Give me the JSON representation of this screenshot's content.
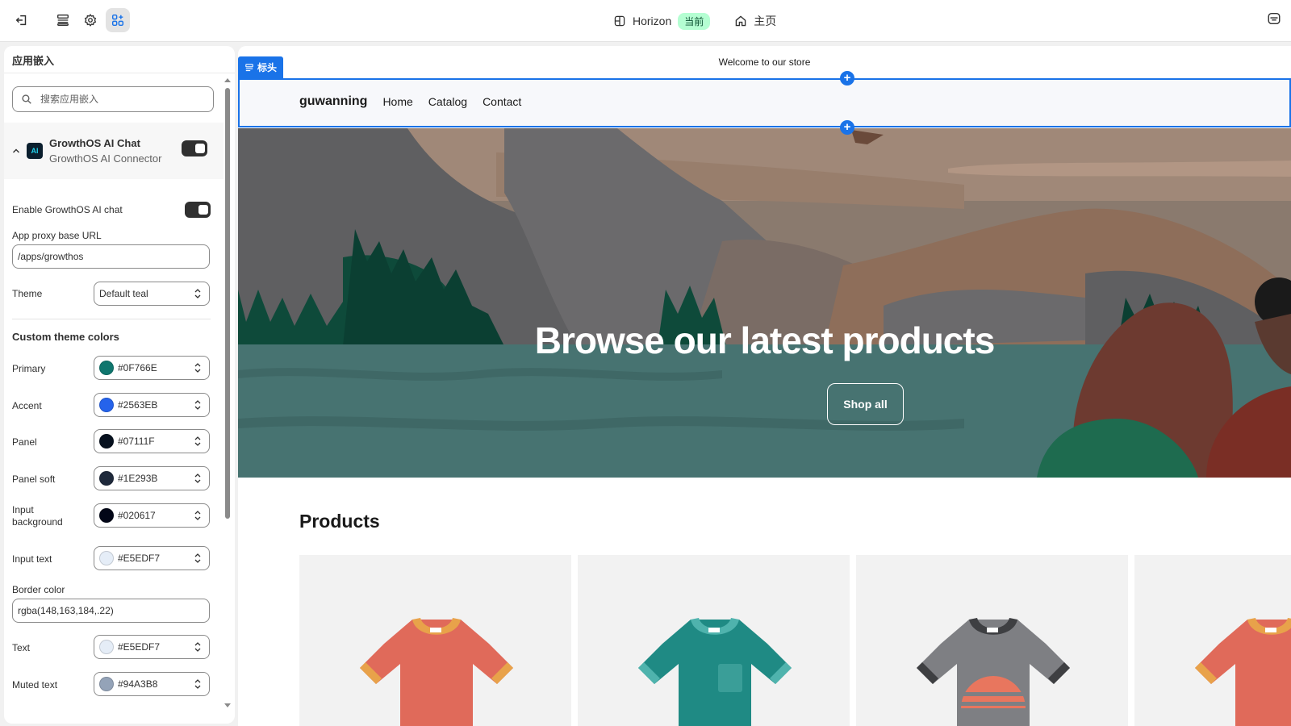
{
  "topbar": {
    "theme_name": "Horizon",
    "current_badge": "当前",
    "home_label": "主页",
    "icons": [
      "exit-icon",
      "sections-icon",
      "gear-icon",
      "apps-icon",
      "account-icon"
    ]
  },
  "sidebar": {
    "title": "应用嵌入",
    "search_placeholder": "搜索应用嵌入",
    "app": {
      "title": "GrowthOS AI Chat",
      "subtitle": "GrowthOS AI Connector",
      "logo_text": "AI",
      "enabled": true
    },
    "enable_chat_label": "Enable GrowthOS AI chat",
    "enable_chat_on": true,
    "proxy_label": "App proxy base URL",
    "proxy_value": "/apps/growthos",
    "theme_label": "Theme",
    "theme_value": "Default teal",
    "custom_colors_title": "Custom theme colors",
    "colors": [
      {
        "label": "Primary",
        "value": "#0F766E",
        "swatch": "#0F766E"
      },
      {
        "label": "Accent",
        "value": "#2563EB",
        "swatch": "#2563EB"
      },
      {
        "label": "Panel",
        "value": "#07111F",
        "swatch": "#07111F"
      },
      {
        "label": "Panel soft",
        "value": "#1E293B",
        "swatch": "#1E293B"
      },
      {
        "label": "Input\nbackground",
        "value": "#020617",
        "swatch": "#020617"
      },
      {
        "label": "Input text",
        "value": "#E5EDF7",
        "swatch": "#E5EDF7"
      }
    ],
    "border_label": "Border color",
    "border_value": "rgba(148,163,184,.22)",
    "colors2": [
      {
        "label": "Text",
        "value": "#E5EDF7",
        "swatch": "#E5EDF7"
      },
      {
        "label": "Muted text",
        "value": "#94A3B8",
        "swatch": "#94A3B8"
      }
    ]
  },
  "preview": {
    "announcement": "Welcome to our store",
    "header_tag": "标头",
    "brand": "guwanning",
    "nav": [
      "Home",
      "Catalog",
      "Contact"
    ],
    "hero_title": "Browse our latest products",
    "hero_button": "Shop all",
    "products_title": "Products",
    "accent_color": "#1a73e8"
  }
}
